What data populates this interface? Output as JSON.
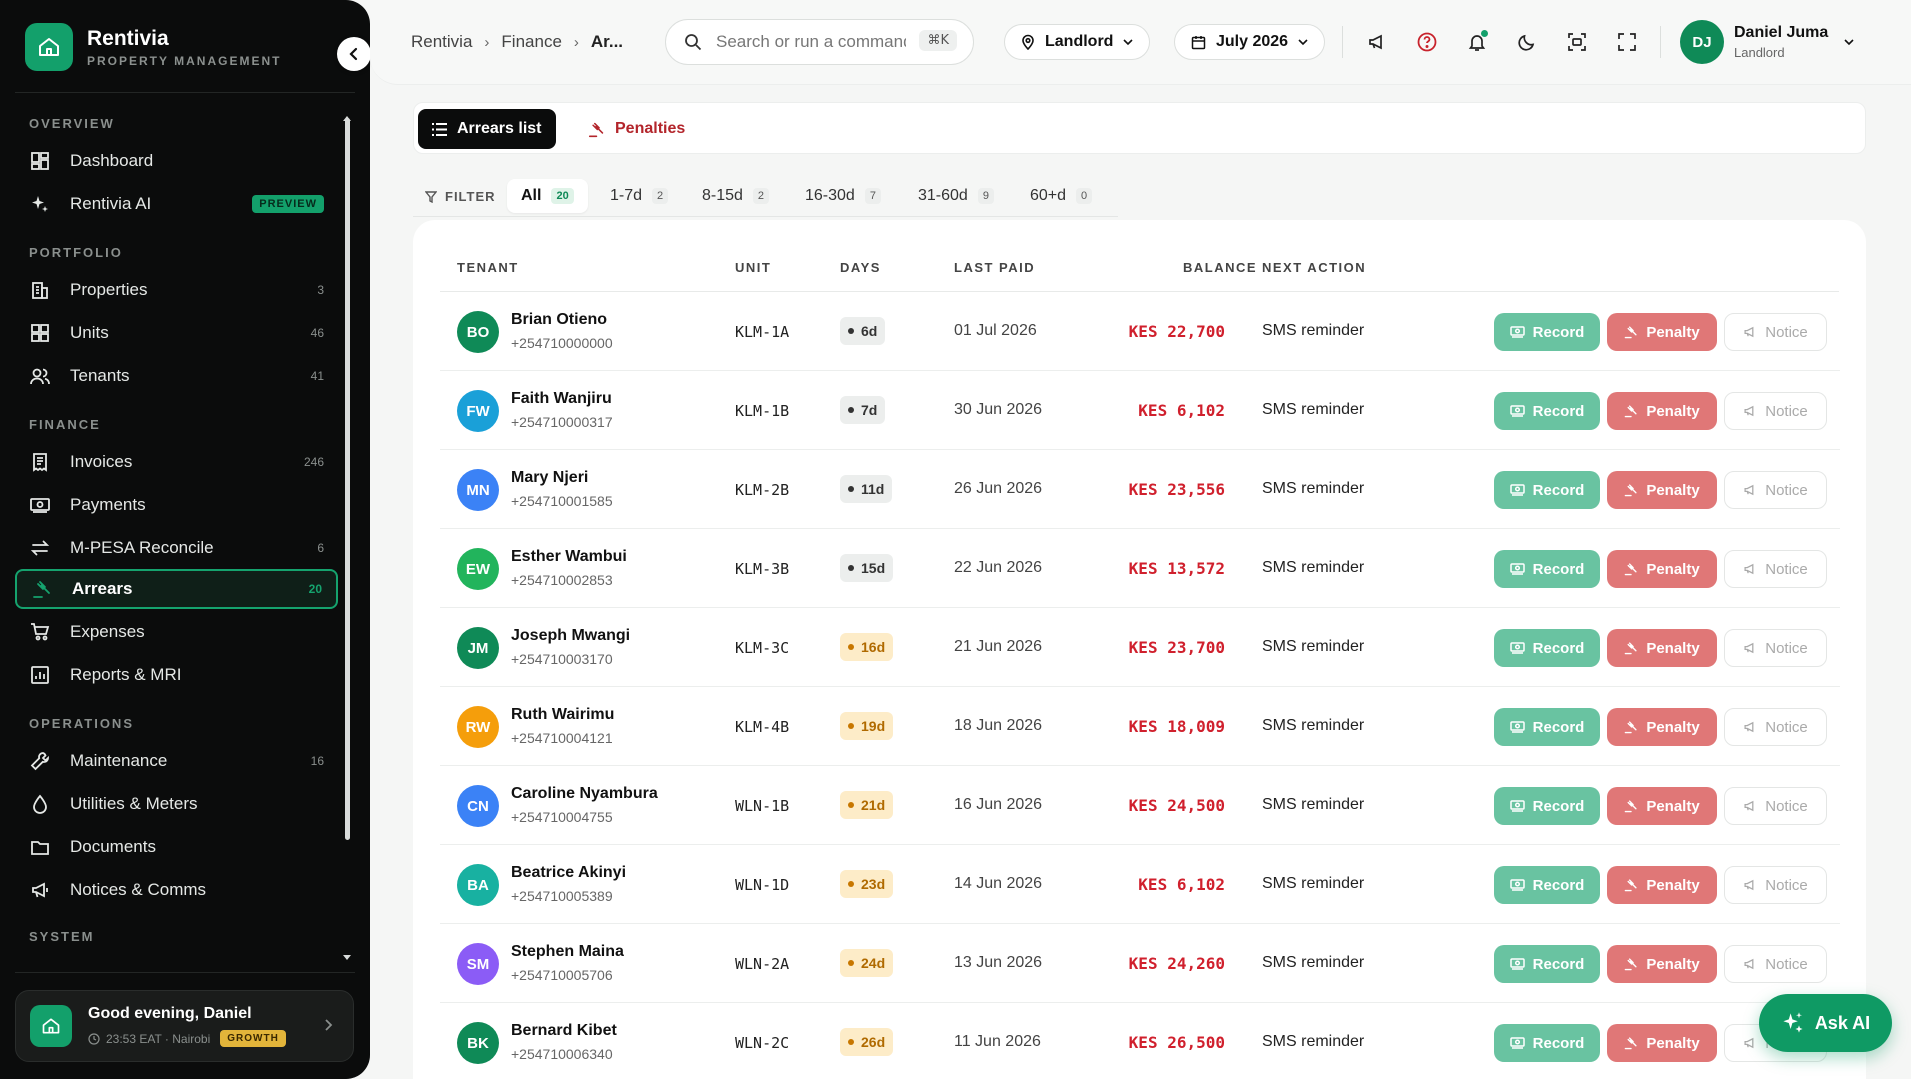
{
  "brand": {
    "name": "Rentivia",
    "subtitle": "PROPERTY MANAGEMENT"
  },
  "sidebar": {
    "sections": {
      "overview": "OVERVIEW",
      "portfolio": "PORTFOLIO",
      "finance": "FINANCE",
      "operations": "OPERATIONS",
      "system": "SYSTEM"
    },
    "items": {
      "dashboard": {
        "label": "Dashboard"
      },
      "rentivia_ai": {
        "label": "Rentivia AI",
        "badge": "PREVIEW"
      },
      "properties": {
        "label": "Properties",
        "count": "3"
      },
      "units": {
        "label": "Units",
        "count": "46"
      },
      "tenants": {
        "label": "Tenants",
        "count": "41"
      },
      "invoices": {
        "label": "Invoices",
        "count": "246"
      },
      "payments": {
        "label": "Payments"
      },
      "mpesa": {
        "label": "M-PESA Reconcile",
        "count": "6"
      },
      "arrears": {
        "label": "Arrears",
        "count": "20"
      },
      "expenses": {
        "label": "Expenses"
      },
      "reports": {
        "label": "Reports & MRI"
      },
      "maintenance": {
        "label": "Maintenance",
        "count": "16"
      },
      "utilities": {
        "label": "Utilities & Meters"
      },
      "documents": {
        "label": "Documents"
      },
      "notices": {
        "label": "Notices & Comms"
      }
    },
    "greeting": {
      "title": "Good evening, Daniel",
      "meta": "23:53 EAT · Nairobi",
      "plan": "GROWTH"
    }
  },
  "header": {
    "breadcrumb": [
      "Rentivia",
      "Finance",
      "Ar..."
    ],
    "search": {
      "placeholder": "Search or run a command",
      "shortcut": "⌘K"
    },
    "role_selector": "Landlord",
    "period_selector": "July 2026",
    "user": {
      "initials": "DJ",
      "name": "Daniel Juma",
      "role": "Landlord"
    }
  },
  "view_tabs": {
    "arrears_list": "Arrears list",
    "penalties": "Penalties"
  },
  "filters": {
    "label": "FILTER",
    "chips": [
      {
        "label": "All",
        "count": "20"
      },
      {
        "label": "1-7d",
        "count": "2"
      },
      {
        "label": "8-15d",
        "count": "2"
      },
      {
        "label": "16-30d",
        "count": "7"
      },
      {
        "label": "31-60d",
        "count": "9"
      },
      {
        "label": "60+d",
        "count": "0"
      }
    ]
  },
  "table": {
    "columns": {
      "tenant": "TENANT",
      "unit": "UNIT",
      "days": "DAYS",
      "last_paid": "LAST PAID",
      "balance": "BALANCE",
      "next_action": "NEXT ACTION"
    },
    "actions": {
      "record": "Record",
      "penalty": "Penalty",
      "notice": "Notice"
    },
    "rows": [
      {
        "initials": "BO",
        "name": "Brian Otieno",
        "phone": "+254710000000",
        "unit": "KLM-1A",
        "days": "6d",
        "last_paid": "01 Jul 2026",
        "balance": "KES 22,700",
        "next_action": "SMS reminder"
      },
      {
        "initials": "FW",
        "name": "Faith Wanjiru",
        "phone": "+254710000317",
        "unit": "KLM-1B",
        "days": "7d",
        "last_paid": "30 Jun 2026",
        "balance": "KES 6,102",
        "next_action": "SMS reminder"
      },
      {
        "initials": "MN",
        "name": "Mary Njeri",
        "phone": "+254710001585",
        "unit": "KLM-2B",
        "days": "11d",
        "last_paid": "26 Jun 2026",
        "balance": "KES 23,556",
        "next_action": "SMS reminder"
      },
      {
        "initials": "EW",
        "name": "Esther Wambui",
        "phone": "+254710002853",
        "unit": "KLM-3B",
        "days": "15d",
        "last_paid": "22 Jun 2026",
        "balance": "KES 13,572",
        "next_action": "SMS reminder"
      },
      {
        "initials": "JM",
        "name": "Joseph Mwangi",
        "phone": "+254710003170",
        "unit": "KLM-3C",
        "days": "16d",
        "last_paid": "21 Jun 2026",
        "balance": "KES 23,700",
        "next_action": "SMS reminder"
      },
      {
        "initials": "RW",
        "name": "Ruth Wairimu",
        "phone": "+254710004121",
        "unit": "KLM-4B",
        "days": "19d",
        "last_paid": "18 Jun 2026",
        "balance": "KES 18,009",
        "next_action": "SMS reminder"
      },
      {
        "initials": "CN",
        "name": "Caroline Nyambura",
        "phone": "+254710004755",
        "unit": "WLN-1B",
        "days": "21d",
        "last_paid": "16 Jun 2026",
        "balance": "KES 24,500",
        "next_action": "SMS reminder"
      },
      {
        "initials": "BA",
        "name": "Beatrice Akinyi",
        "phone": "+254710005389",
        "unit": "WLN-1D",
        "days": "23d",
        "last_paid": "14 Jun 2026",
        "balance": "KES 6,102",
        "next_action": "SMS reminder"
      },
      {
        "initials": "SM",
        "name": "Stephen Maina",
        "phone": "+254710005706",
        "unit": "WLN-2A",
        "days": "24d",
        "last_paid": "13 Jun 2026",
        "balance": "KES 24,260",
        "next_action": "SMS reminder"
      },
      {
        "initials": "BK",
        "name": "Bernard Kibet",
        "phone": "+254710006340",
        "unit": "WLN-2C",
        "days": "26d",
        "last_paid": "11 Jun 2026",
        "balance": "KES 26,500",
        "next_action": "SMS reminder"
      }
    ]
  },
  "ask_ai": "Ask AI",
  "colors": {
    "brand_green": "#13a06b",
    "arrears_red": "#d0202d",
    "avatar_colors": [
      "#0f8a57",
      "#1aa0d8",
      "#3b82f6",
      "#22b45c",
      "#0f8a57",
      "#f59e0b",
      "#3b82f6",
      "#18b1a1",
      "#8b5cf6",
      "#0f8a57"
    ]
  }
}
